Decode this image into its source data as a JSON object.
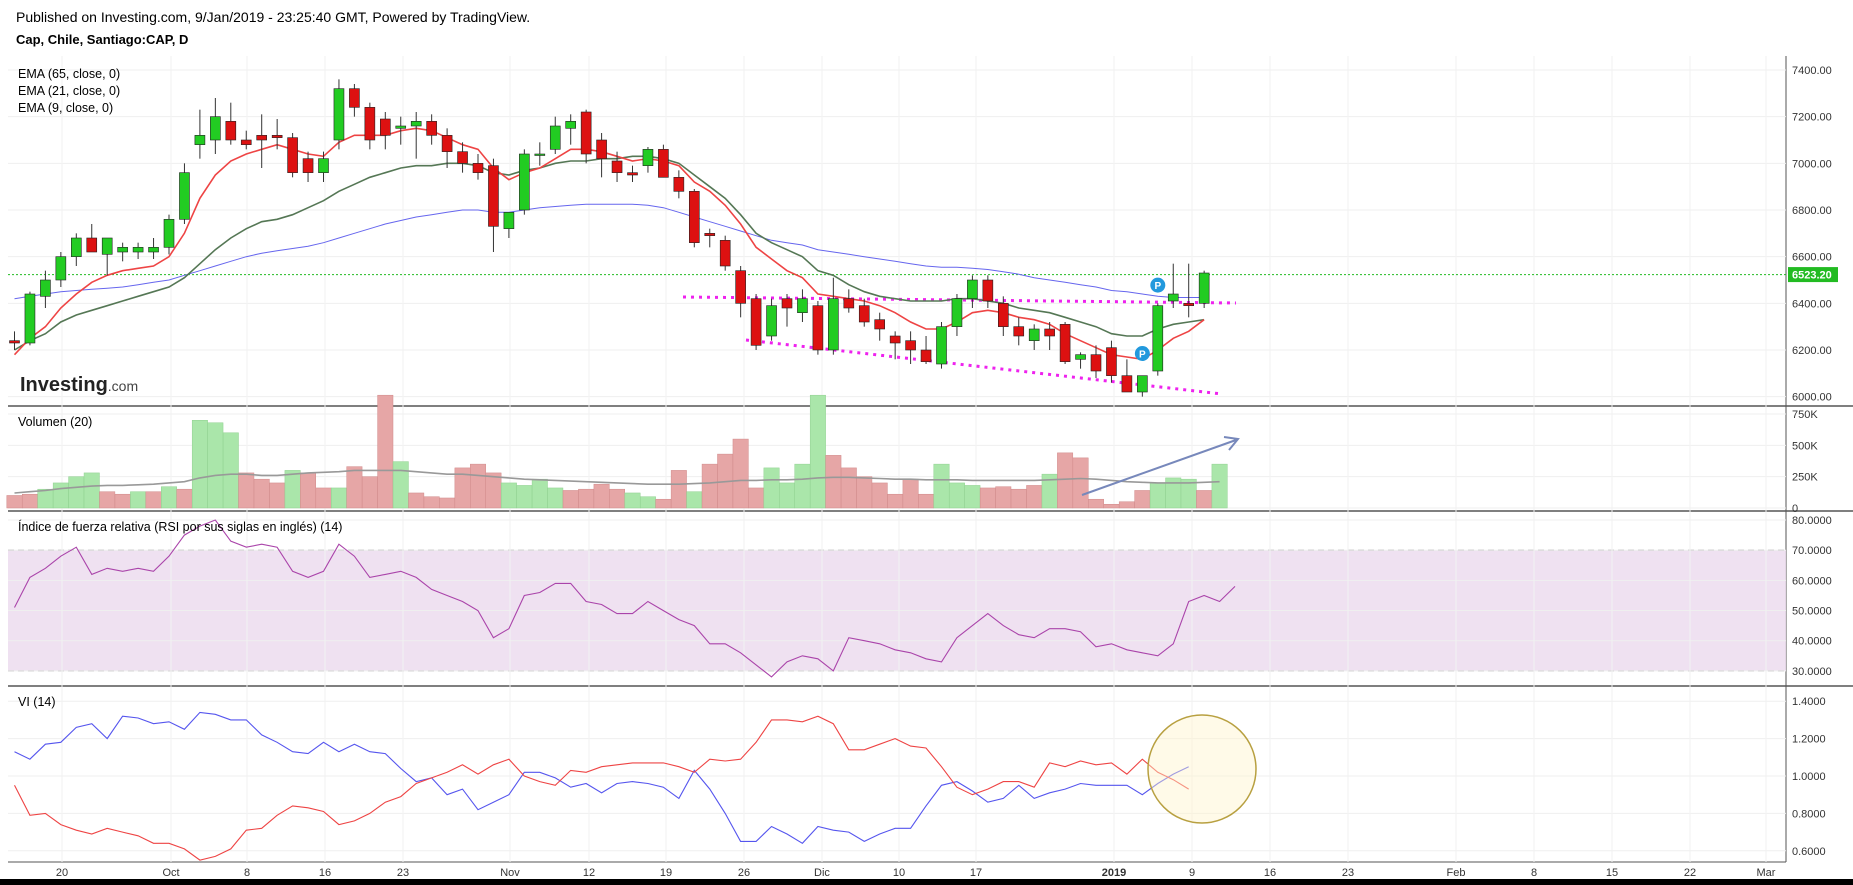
{
  "header": {
    "published": "Published on Investing.com, 9/Jan/2019 - 23:25:40 GMT, Powered by TradingView.",
    "symbol": "Cap, Chile, Santiago:CAP, D"
  },
  "logo": {
    "brand": "Investing",
    "suffix": ".com"
  },
  "colors": {
    "up": "#22cc22",
    "down": "#dd1111",
    "ema9": "#ee4444",
    "ema21": "#557755",
    "ema65": "#6666ee",
    "rsi": "#aa44aa",
    "vip": "#5555ee",
    "vim": "#ee4444",
    "trend": "#ee22ee",
    "marker": "#2299dd",
    "lastPrice": "#22bb22",
    "volUp": "#aae6aa",
    "volDown": "#e6a6a6",
    "volMa": "#999999",
    "arrow": "#7788bb",
    "circle": "#b8a040"
  },
  "chart_data": [
    {
      "type": "candlestick",
      "title": "Cap, Chile, Santiago:CAP, D",
      "legend": [
        "EMA (65, close, 0)",
        "EMA (21, close, 0)",
        "EMA (9, close, 0)"
      ],
      "yticks": [
        "7400.00",
        "7200.00",
        "7000.00",
        "6800.00",
        "6600.00",
        "6400.00",
        "6200.00",
        "6000.00"
      ],
      "ylim": [
        5960,
        7460
      ],
      "last_price_label": "6523.20",
      "last_price": 6523.2,
      "x_labels": [
        "20",
        "Oct",
        "8",
        "16",
        "23",
        "Nov",
        "12",
        "19",
        "26",
        "Dic",
        "10",
        "17",
        "2019",
        "9",
        "16",
        "23",
        "Feb",
        "8",
        "15",
        "22",
        "Mar"
      ],
      "candles": [
        [
          6240,
          6280,
          6200,
          6230
        ],
        [
          6230,
          6450,
          6220,
          6440
        ],
        [
          6430,
          6540,
          6380,
          6500
        ],
        [
          6500,
          6620,
          6470,
          6600
        ],
        [
          6600,
          6700,
          6560,
          6680
        ],
        [
          6680,
          6740,
          6620,
          6620
        ],
        [
          6610,
          6670,
          6520,
          6680
        ],
        [
          6620,
          6660,
          6580,
          6640
        ],
        [
          6620,
          6660,
          6590,
          6640
        ],
        [
          6620,
          6680,
          6590,
          6640
        ],
        [
          6640,
          6780,
          6610,
          6760
        ],
        [
          6760,
          7000,
          6740,
          6960
        ],
        [
          7080,
          7230,
          7020,
          7120
        ],
        [
          7100,
          7280,
          7040,
          7200
        ],
        [
          7180,
          7260,
          7080,
          7100
        ],
        [
          7100,
          7140,
          7060,
          7080
        ],
        [
          7120,
          7210,
          6980,
          7100
        ],
        [
          7120,
          7190,
          7060,
          7110
        ],
        [
          7110,
          7130,
          6940,
          6960
        ],
        [
          7020,
          7050,
          6920,
          6960
        ],
        [
          6960,
          7050,
          6920,
          7020
        ],
        [
          7100,
          7360,
          7060,
          7320
        ],
        [
          7320,
          7340,
          7200,
          7240
        ],
        [
          7240,
          7260,
          7060,
          7100
        ],
        [
          7190,
          7220,
          7060,
          7120
        ],
        [
          7150,
          7200,
          7080,
          7160
        ],
        [
          7160,
          7220,
          7020,
          7180
        ],
        [
          7180,
          7210,
          7080,
          7120
        ],
        [
          7120,
          7150,
          6980,
          7050
        ],
        [
          7050,
          7090,
          6960,
          7000
        ],
        [
          7000,
          7040,
          6930,
          6960
        ],
        [
          6990,
          7020,
          6620,
          6730
        ],
        [
          6720,
          6780,
          6680,
          6790
        ],
        [
          6800,
          7060,
          6780,
          7040
        ],
        [
          7040,
          7090,
          6990,
          7040
        ],
        [
          7060,
          7200,
          7040,
          7160
        ],
        [
          7150,
          7210,
          7080,
          7180
        ],
        [
          7220,
          7230,
          7000,
          7040
        ],
        [
          7100,
          7130,
          6940,
          7020
        ],
        [
          7010,
          7050,
          6920,
          6960
        ],
        [
          6960,
          6990,
          6920,
          6950
        ],
        [
          6990,
          7070,
          6960,
          7060
        ],
        [
          7060,
          7080,
          6940,
          6940
        ],
        [
          6940,
          6970,
          6850,
          6880
        ],
        [
          6880,
          6890,
          6640,
          6660
        ],
        [
          6700,
          6720,
          6640,
          6690
        ],
        [
          6670,
          6690,
          6540,
          6560
        ],
        [
          6540,
          6560,
          6340,
          6400
        ],
        [
          6420,
          6440,
          6200,
          6220
        ],
        [
          6260,
          6420,
          6240,
          6390
        ],
        [
          6420,
          6440,
          6300,
          6380
        ],
        [
          6360,
          6460,
          6320,
          6420
        ],
        [
          6390,
          6410,
          6180,
          6200
        ],
        [
          6200,
          6510,
          6180,
          6420
        ],
        [
          6420,
          6460,
          6360,
          6380
        ],
        [
          6390,
          6420,
          6300,
          6320
        ],
        [
          6330,
          6360,
          6240,
          6290
        ],
        [
          6260,
          6280,
          6160,
          6230
        ],
        [
          6240,
          6280,
          6140,
          6200
        ],
        [
          6200,
          6260,
          6140,
          6150
        ],
        [
          6140,
          6320,
          6120,
          6300
        ],
        [
          6300,
          6440,
          6260,
          6420
        ],
        [
          6420,
          6520,
          6380,
          6500
        ],
        [
          6500,
          6520,
          6380,
          6410
        ],
        [
          6400,
          6430,
          6260,
          6300
        ],
        [
          6300,
          6340,
          6220,
          6260
        ],
        [
          6240,
          6310,
          6200,
          6290
        ],
        [
          6290,
          6320,
          6200,
          6260
        ],
        [
          6310,
          6320,
          6140,
          6150
        ],
        [
          6160,
          6190,
          6120,
          6180
        ],
        [
          6180,
          6220,
          6080,
          6110
        ],
        [
          6210,
          6240,
          6060,
          6090
        ],
        [
          6090,
          6160,
          6050,
          6020
        ],
        [
          6020,
          6090,
          6000,
          6090
        ],
        [
          6110,
          6400,
          6090,
          6390
        ],
        [
          6410,
          6570,
          6380,
          6440
        ],
        [
          6400,
          6570,
          6340,
          6390
        ],
        [
          6400,
          6540,
          6380,
          6530
        ]
      ],
      "ema9": [
        6180,
        6250,
        6300,
        6380,
        6440,
        6490,
        6520,
        6540,
        6550,
        6560,
        6600,
        6700,
        6850,
        6950,
        7010,
        7040,
        7060,
        7080,
        7060,
        7040,
        7030,
        7090,
        7120,
        7120,
        7120,
        7140,
        7150,
        7140,
        7110,
        7080,
        7060,
        6980,
        6930,
        6960,
        6980,
        7020,
        7060,
        7060,
        7050,
        7030,
        7010,
        7020,
        7010,
        6990,
        6920,
        6880,
        6820,
        6740,
        6640,
        6590,
        6540,
        6510,
        6440,
        6430,
        6420,
        6410,
        6390,
        6360,
        6320,
        6290,
        6290,
        6320,
        6360,
        6370,
        6360,
        6340,
        6330,
        6310,
        6270,
        6240,
        6210,
        6180,
        6170,
        6160,
        6200,
        6250,
        6280,
        6330
      ],
      "ema21": [
        6200,
        6240,
        6270,
        6320,
        6350,
        6370,
        6390,
        6410,
        6430,
        6450,
        6470,
        6510,
        6570,
        6630,
        6680,
        6720,
        6750,
        6760,
        6780,
        6810,
        6840,
        6880,
        6910,
        6940,
        6960,
        6980,
        6990,
        6990,
        7000,
        7000,
        6990,
        6960,
        6950,
        6970,
        6980,
        7000,
        7010,
        7010,
        7020,
        7020,
        7030,
        7030,
        7020,
        7000,
        6950,
        6900,
        6850,
        6780,
        6700,
        6660,
        6630,
        6600,
        6540,
        6520,
        6480,
        6450,
        6430,
        6420,
        6410,
        6410,
        6410,
        6420,
        6420,
        6410,
        6400,
        6380,
        6370,
        6360,
        6340,
        6320,
        6300,
        6270,
        6260,
        6260,
        6290,
        6310,
        6320,
        6330
      ],
      "ema65": [
        6420,
        6430,
        6440,
        6450,
        6455,
        6460,
        6465,
        6470,
        6480,
        6490,
        6500,
        6520,
        6540,
        6560,
        6580,
        6600,
        6615,
        6625,
        6635,
        6645,
        6660,
        6680,
        6700,
        6720,
        6740,
        6755,
        6770,
        6780,
        6790,
        6800,
        6800,
        6790,
        6790,
        6800,
        6810,
        6815,
        6820,
        6825,
        6825,
        6825,
        6825,
        6820,
        6810,
        6790,
        6770,
        6750,
        6730,
        6710,
        6690,
        6670,
        6660,
        6650,
        6630,
        6620,
        6610,
        6600,
        6590,
        6580,
        6570,
        6560,
        6555,
        6555,
        6550,
        6545,
        6535,
        6525,
        6510,
        6500,
        6490,
        6480,
        6470,
        6455,
        6450,
        6440,
        6430,
        6425,
        6425,
        6425
      ],
      "markers": [
        {
          "label": "P",
          "bar": 73,
          "value": 6185
        },
        {
          "label": "P",
          "bar": 74,
          "value": 6478
        }
      ]
    },
    {
      "type": "bar",
      "title": "Volumen (20)",
      "yticks": [
        "750K",
        "500K",
        "250K",
        "0"
      ],
      "ylim": [
        0,
        750000
      ],
      "volume": [
        100000,
        110000,
        150000,
        200000,
        250000,
        280000,
        130000,
        110000,
        130000,
        130000,
        170000,
        150000,
        700000,
        680000,
        600000,
        280000,
        230000,
        200000,
        300000,
        280000,
        160000,
        160000,
        330000,
        250000,
        900000,
        370000,
        120000,
        90000,
        80000,
        320000,
        350000,
        280000,
        200000,
        180000,
        230000,
        160000,
        140000,
        150000,
        190000,
        150000,
        120000,
        90000,
        70000,
        300000,
        130000,
        350000,
        430000,
        550000,
        160000,
        320000,
        200000,
        350000,
        900000,
        420000,
        320000,
        250000,
        200000,
        110000,
        230000,
        110000,
        350000,
        200000,
        180000,
        160000,
        170000,
        150000,
        180000,
        270000,
        440000,
        400000,
        70000,
        30000,
        50000,
        140000,
        200000,
        240000,
        230000,
        140000,
        350000
      ],
      "vol_up": [
        false,
        false,
        true,
        true,
        true,
        true,
        false,
        false,
        true,
        false,
        true,
        false,
        true,
        true,
        true,
        false,
        false,
        false,
        true,
        false,
        false,
        true,
        false,
        false,
        false,
        true,
        false,
        false,
        false,
        false,
        false,
        false,
        true,
        true,
        true,
        true,
        false,
        false,
        false,
        false,
        true,
        true,
        false,
        false,
        true,
        false,
        false,
        false,
        false,
        true,
        true,
        true,
        true,
        false,
        false,
        false,
        false,
        false,
        false,
        false,
        true,
        true,
        true,
        false,
        false,
        false,
        false,
        true,
        false,
        false,
        false,
        false,
        false,
        false,
        true,
        true,
        true,
        false,
        true
      ],
      "vol_ma": [
        120000,
        130000,
        140000,
        155000,
        165000,
        175000,
        180000,
        180000,
        185000,
        190000,
        200000,
        210000,
        240000,
        260000,
        270000,
        270000,
        260000,
        260000,
        270000,
        280000,
        285000,
        290000,
        300000,
        300000,
        300000,
        300000,
        290000,
        280000,
        270000,
        270000,
        260000,
        250000,
        240000,
        230000,
        225000,
        220000,
        215000,
        210000,
        205000,
        200000,
        195000,
        190000,
        190000,
        190000,
        195000,
        200000,
        210000,
        220000,
        220000,
        225000,
        225000,
        230000,
        240000,
        245000,
        245000,
        240000,
        235000,
        230000,
        230000,
        225000,
        225000,
        225000,
        220000,
        220000,
        220000,
        220000,
        220000,
        225000,
        230000,
        235000,
        230000,
        220000,
        210000,
        205000,
        200000,
        200000,
        200000,
        205000,
        210000
      ]
    },
    {
      "type": "line",
      "title": "Índice de fuerza relativa (RSI por sus siglas en inglés) (14)",
      "yticks": [
        "80.0000",
        "70.0000",
        "60.0000",
        "50.0000",
        "40.0000",
        "30.0000"
      ],
      "ylim": [
        25,
        82
      ],
      "band": [
        30,
        70
      ],
      "rsi": [
        51,
        61,
        64,
        68,
        71,
        62,
        64,
        63,
        64,
        63,
        68,
        75,
        78,
        80,
        73,
        71,
        72,
        71,
        63,
        61,
        63,
        72,
        68,
        61,
        62,
        63,
        61,
        57,
        55,
        53,
        50,
        41,
        44,
        55,
        56,
        59,
        59,
        53,
        52,
        49,
        49,
        53,
        50,
        47,
        45,
        39,
        39,
        36,
        32,
        28,
        33,
        35,
        34,
        30,
        41,
        40,
        39,
        37,
        36,
        34,
        33,
        41,
        45,
        49,
        45,
        42,
        41,
        44,
        44,
        43,
        38,
        39,
        37,
        36,
        35,
        39,
        53,
        55,
        53,
        58
      ]
    },
    {
      "type": "line",
      "title": "VI (14)",
      "yticks": [
        "1.4000",
        "1.2000",
        "1.0000",
        "0.8000",
        "0.6000"
      ],
      "ylim": [
        0.54,
        1.46
      ],
      "vi_plus": [
        1.13,
        1.09,
        1.17,
        1.18,
        1.26,
        1.28,
        1.2,
        1.32,
        1.31,
        1.28,
        1.29,
        1.25,
        1.34,
        1.33,
        1.3,
        1.3,
        1.22,
        1.18,
        1.13,
        1.12,
        1.18,
        1.13,
        1.17,
        1.13,
        1.12,
        1.04,
        0.97,
        0.99,
        0.9,
        0.93,
        0.82,
        0.86,
        0.9,
        1.02,
        1.02,
        0.99,
        0.94,
        0.96,
        0.91,
        0.96,
        0.97,
        0.96,
        0.94,
        0.88,
        1.03,
        0.93,
        0.8,
        0.65,
        0.65,
        0.73,
        0.69,
        0.64,
        0.73,
        0.71,
        0.7,
        0.65,
        0.69,
        0.72,
        0.72,
        0.84,
        0.95,
        0.97,
        0.92,
        0.86,
        0.88,
        0.95,
        0.88,
        0.91,
        0.93,
        0.96,
        0.95,
        0.95,
        0.95,
        0.9,
        0.96,
        1.01,
        1.05
      ],
      "vi_minus": [
        0.95,
        0.79,
        0.8,
        0.74,
        0.71,
        0.69,
        0.72,
        0.7,
        0.68,
        0.64,
        0.64,
        0.61,
        0.55,
        0.57,
        0.61,
        0.71,
        0.72,
        0.79,
        0.84,
        0.83,
        0.81,
        0.74,
        0.76,
        0.8,
        0.86,
        0.89,
        0.96,
        0.99,
        1.02,
        1.06,
        1.01,
        1.06,
        1.09,
        1.0,
        0.97,
        0.95,
        1.03,
        1.02,
        1.05,
        1.06,
        1.07,
        1.07,
        1.07,
        1.05,
        1.02,
        1.09,
        1.08,
        1.09,
        1.18,
        1.3,
        1.3,
        1.29,
        1.32,
        1.28,
        1.14,
        1.14,
        1.17,
        1.2,
        1.16,
        1.15,
        1.05,
        0.94,
        0.9,
        0.93,
        0.97,
        0.97,
        0.94,
        1.07,
        1.05,
        1.08,
        1.06,
        1.07,
        1.01,
        1.09,
        1.02,
        0.98,
        0.93
      ]
    }
  ]
}
